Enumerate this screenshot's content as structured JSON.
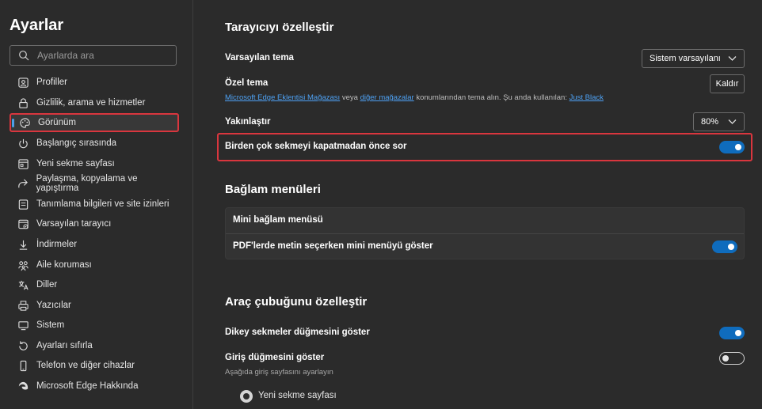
{
  "sidebar": {
    "title": "Ayarlar",
    "search_placeholder": "Ayarlarda ara",
    "items": [
      {
        "label": "Profiller",
        "icon": "profile-icon"
      },
      {
        "label": "Gizlilik, arama ve hizmetler",
        "icon": "lock-icon"
      },
      {
        "label": "Görünüm",
        "icon": "palette-icon",
        "active": true
      },
      {
        "label": "Başlangıç sırasında",
        "icon": "power-icon"
      },
      {
        "label": "Yeni sekme sayfası",
        "icon": "new-tab-icon"
      },
      {
        "label": "Paylaşma, kopyalama ve yapıştırma",
        "icon": "share-icon"
      },
      {
        "label": "Tanımlama bilgileri ve site izinleri",
        "icon": "cookie-icon"
      },
      {
        "label": "Varsayılan tarayıcı",
        "icon": "browser-icon"
      },
      {
        "label": "İndirmeler",
        "icon": "download-icon"
      },
      {
        "label": "Aile koruması",
        "icon": "family-icon"
      },
      {
        "label": "Diller",
        "icon": "language-icon"
      },
      {
        "label": "Yazıcılar",
        "icon": "printer-icon"
      },
      {
        "label": "Sistem",
        "icon": "monitor-icon"
      },
      {
        "label": "Ayarları sıfırla",
        "icon": "reset-icon"
      },
      {
        "label": "Telefon ve diğer cihazlar",
        "icon": "phone-icon"
      },
      {
        "label": "Microsoft Edge Hakkında",
        "icon": "edge-icon"
      }
    ]
  },
  "main": {
    "customize_title": "Tarayıcıyı özelleştir",
    "default_theme": {
      "label": "Varsayılan tema",
      "value": "Sistem varsayılanı"
    },
    "custom_theme": {
      "label": "Özel tema",
      "remove_label": "Kaldır",
      "link1": "Microsoft Edge Eklentisi Mağazası",
      "text1": " veya ",
      "link2": "diğer mağazalar",
      "text2": " konumlarından tema alın. Şu anda kullanılan: ",
      "link3": "Just Black"
    },
    "zoom": {
      "label": "Yakınlaştır",
      "value": "80%"
    },
    "ask_close_tabs": {
      "label": "Birden çok sekmeyi kapatmadan önce sor",
      "on": true
    },
    "context_title": "Bağlam menüleri",
    "mini_menu_header": "Mini bağlam menüsü",
    "pdf_mini_menu": {
      "label": "PDF'lerde metin seçerken mini menüyü göster",
      "on": true
    },
    "toolbar_title": "Araç çubuğunu özelleştir",
    "vertical_tabs": {
      "label": "Dikey sekmeler düğmesini göster",
      "on": true
    },
    "home_button": {
      "label": "Giriş düğmesini göster",
      "sub": "Aşağıda giriş sayfasını ayarlayın",
      "on": false
    },
    "new_tab_option": "Yeni sekme sayfası"
  },
  "colors": {
    "accent": "#0f6cbd",
    "highlight": "#d9363e",
    "link": "#4ea1f3",
    "background": "#2b2b2b"
  }
}
